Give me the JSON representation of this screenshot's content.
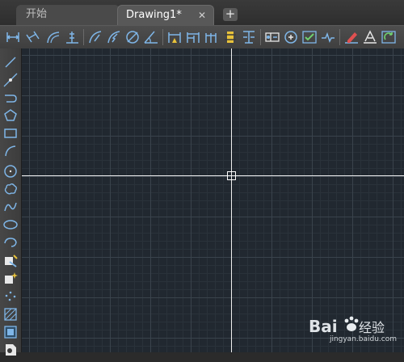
{
  "tabs": [
    {
      "label": "开始",
      "active": false
    },
    {
      "label": "Drawing1*",
      "active": true
    }
  ],
  "tab_close_glyph": "✕",
  "tab_add_glyph": "+",
  "toolbar_icons": [
    "linear-dimension-icon",
    "aligned-dimension-icon",
    "arc-length-dimension-icon",
    "ordinate-dimension-icon",
    "radius-dimension-icon",
    "jogged-dimension-icon",
    "diameter-dimension-icon",
    "angular-dimension-icon",
    "quick-dimension-icon",
    "baseline-dimension-icon",
    "continue-dimension-icon",
    "dimension-space-icon",
    "dimension-break-icon",
    "tolerance-icon",
    "center-mark-icon",
    "inspection-icon",
    "jogged-linear-icon",
    "dimension-edit-icon",
    "dimension-text-edit-icon",
    "dimension-update-icon"
  ],
  "left_toolbar_icons": [
    "line-icon",
    "construction-line-icon",
    "polyline-icon",
    "polygon-icon",
    "rectangle-icon",
    "arc-icon",
    "circle-icon",
    "revision-cloud-icon",
    "spline-icon",
    "ellipse-icon",
    "ellipse-arc-icon",
    "insert-block-icon",
    "create-block-icon",
    "point-icon",
    "hatch-icon",
    "gradient-icon",
    "region-icon"
  ],
  "colors": {
    "canvas_background": "#212830",
    "crosshair": "#f0f0f0",
    "icon_blue": "#7fb6e8",
    "icon_yellow": "#e8c23a",
    "icon_green": "#6fd16f",
    "icon_red": "#e05050"
  },
  "watermark": {
    "brand": "Bai经验",
    "site": "jingyan.baidu.com"
  }
}
